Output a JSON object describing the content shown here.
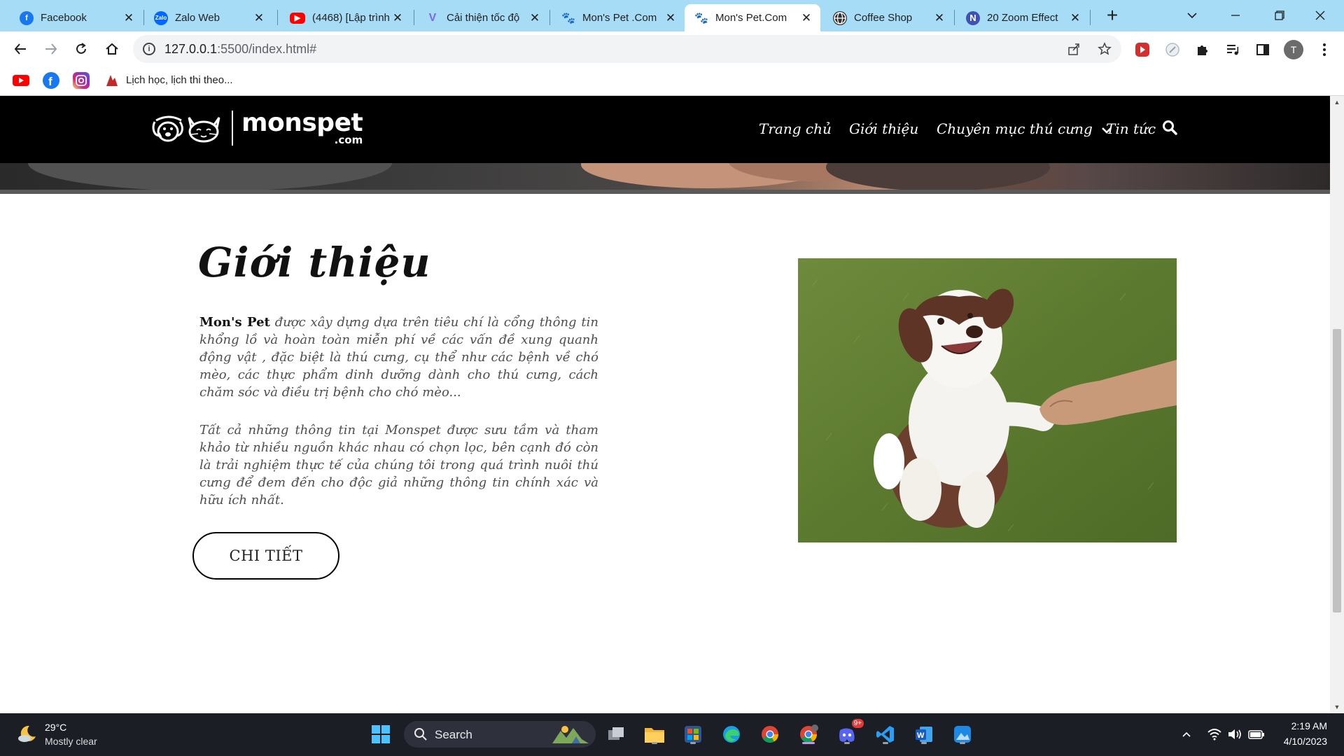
{
  "browser": {
    "tabs": [
      {
        "title": "Facebook",
        "favicon": "facebook-icon",
        "color": "#1877f2"
      },
      {
        "title": "Zalo Web",
        "favicon": "zalo-icon",
        "color": "#0068ff"
      },
      {
        "title": "(4468) [Lập trình",
        "favicon": "youtube-icon",
        "color": "#ff0000"
      },
      {
        "title": "Cải thiện tốc độ",
        "favicon": "v-icon",
        "color": "#7b68ee"
      },
      {
        "title": "Mon's Pet .Com",
        "favicon": "paw-icon",
        "color": "#111111"
      },
      {
        "title": "Mon's Pet.Com",
        "favicon": "paw-icon",
        "color": "#111111",
        "active": true
      },
      {
        "title": "Coffee Shop",
        "favicon": "globe-icon",
        "color": "#333333"
      },
      {
        "title": "20 Zoom Effect",
        "favicon": "n-icon",
        "color": "#3f51b5"
      }
    ],
    "url_host": "127.0.0.1",
    "url_rest": ":5500/index.html#",
    "profile_initial": "T",
    "bookmark_label": "Lịch học, lịch thi theo..."
  },
  "site": {
    "logo_text": "monspet",
    "logo_sub": ".com",
    "menu": [
      "Trang chủ",
      "Giới thiệu",
      "Chuyên mục thú cưng",
      "Tin tức"
    ]
  },
  "intro": {
    "title": "Giới thiệu",
    "para1_brand": "Mon's Pet",
    "para1_text": " được xây dựng dựa trên tiêu chí là cổng thông tin khổng lồ và hoàn toàn miễn phí về các vấn đề xung quanh động vật , đặc biệt là thú cưng, cụ thể như các bệnh về chó mèo, các thực phẩm dinh dưỡng dành cho thú cưng, cách chăm sóc và điều trị bệnh cho chó mèo...",
    "para2": "Tất cả những thông tin tại Monspet được sưu tầm và tham khảo từ nhiều nguồn khác nhau có chọn lọc, bên cạnh đó còn là trải nghiệm thực tế của chúng tôi trong quá trình nuôi thú cưng để đem đến cho độc giả những thông tin chính xác và hữu ích nhất.",
    "button": "CHI TIẾT"
  },
  "taskbar": {
    "weather_temp": "29°C",
    "weather_desc": "Mostly clear",
    "search_label": "Search",
    "time": "2:19 AM",
    "date": "4/10/2023",
    "discord_badge": "9+"
  }
}
